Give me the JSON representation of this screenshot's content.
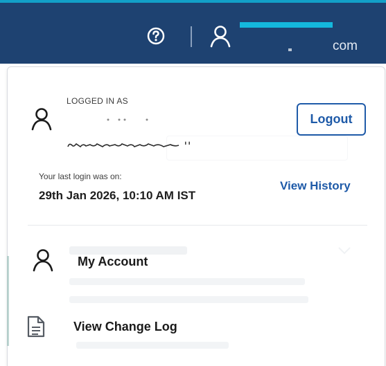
{
  "header": {
    "help_icon": "help-circle-icon",
    "user_icon": "user-icon",
    "account_suffix": "com",
    "accent_color": "#12a0c8",
    "bar_color": "#1e4271"
  },
  "user_panel": {
    "logged_in_label": "LOGGED IN AS",
    "email_partial": "n",
    "logout_label": "Logout",
    "last_login_label": "Your last login was on:",
    "last_login_value": "29th Jan 2026, 10:10 AM IST",
    "view_history_label": "View History"
  },
  "menu": {
    "items": [
      {
        "label": "My Account",
        "icon": "user-icon"
      },
      {
        "label": "View Change Log",
        "icon": "document-icon"
      }
    ]
  },
  "colors": {
    "link": "#1e5aa8",
    "text": "#1a1a1a"
  }
}
